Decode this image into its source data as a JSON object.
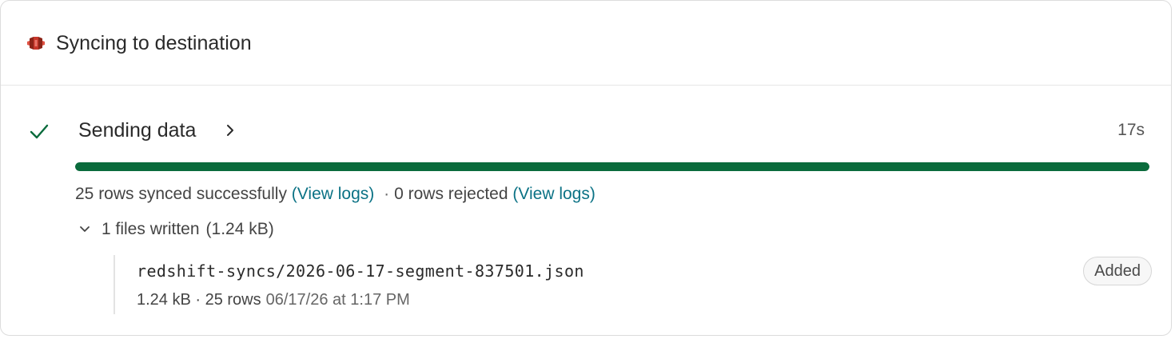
{
  "header": {
    "title": "Syncing to destination",
    "logo_icon": "amazon-s3-logo-icon",
    "logo_color": "#c7372b"
  },
  "step": {
    "status_icon": "check-icon",
    "status_color": "#0a6b3c",
    "title": "Sending data",
    "duration": "17s",
    "progress": 1.0
  },
  "summary": {
    "synced_text": "25 rows synced successfully",
    "synced_link": "(View logs)",
    "separator": "·",
    "rejected_text": "0 rows rejected",
    "rejected_link": "(View logs)"
  },
  "files": {
    "count_label": "1 files written",
    "size_label": "(1.24 kB)",
    "items": [
      {
        "name": "redshift-syncs/2026-06-17-segment-837501.json",
        "meta": "1.24 kB · 25 rows",
        "date": "06/17/26 at 1:17 PM",
        "badge": "Added"
      }
    ]
  },
  "colors": {
    "accent_link": "#0b7285",
    "success": "#0a6b3c"
  }
}
